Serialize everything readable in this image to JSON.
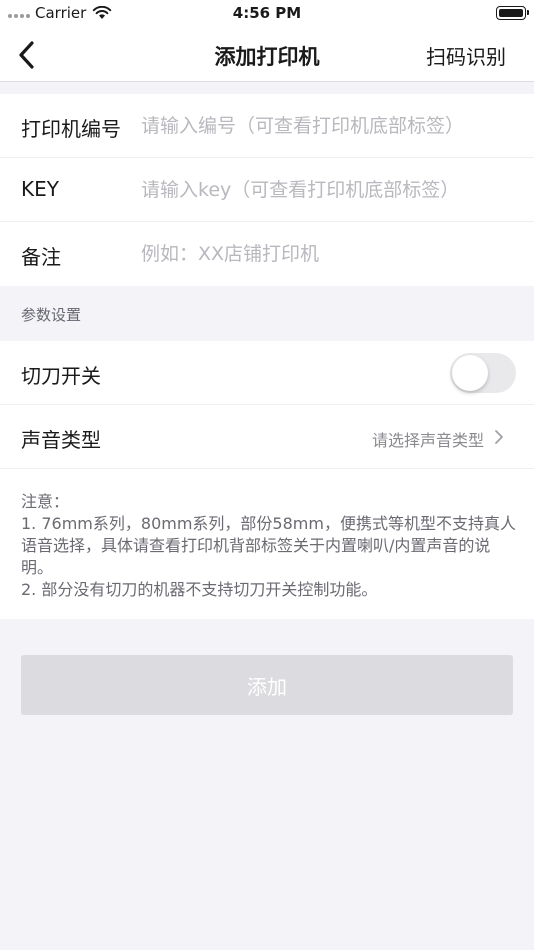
{
  "status_bar": {
    "carrier": "Carrier",
    "time": "4:56 PM"
  },
  "nav": {
    "title": "添加打印机",
    "right_action": "扫码识别",
    "back_icon": "chevron-left-icon"
  },
  "form": {
    "rows": [
      {
        "label": "打印机编号",
        "placeholder": "请输入编号（可查看打印机底部标签）",
        "value": ""
      },
      {
        "label": "KEY",
        "placeholder": "请输入key（可查看打印机底部标签）",
        "value": ""
      },
      {
        "label": "备注",
        "placeholder": "例如：XX店铺打印机",
        "value": ""
      }
    ]
  },
  "params": {
    "header": "参数设置",
    "cutter": {
      "label": "切刀开关",
      "enabled": false
    },
    "sound": {
      "label": "声音类型",
      "placeholder": "请选择声音类型"
    }
  },
  "notes": [
    "注意：",
    "1. 76mm系列，80mm系列，部份58mm，便携式等机型不支持真人语音选择，具体请查看打印机背部标签关于内置喇叭/内置声音的说明。",
    "2. 部分没有切刀的机器不支持切刀开关控制功能。"
  ],
  "submit": {
    "label": "添加",
    "disabled": true
  },
  "colors": {
    "background": "#f4f4f8",
    "disabled_button": "#dcdce0",
    "placeholder": "#b8b8be",
    "toggle_off": "#e9e9ec"
  }
}
